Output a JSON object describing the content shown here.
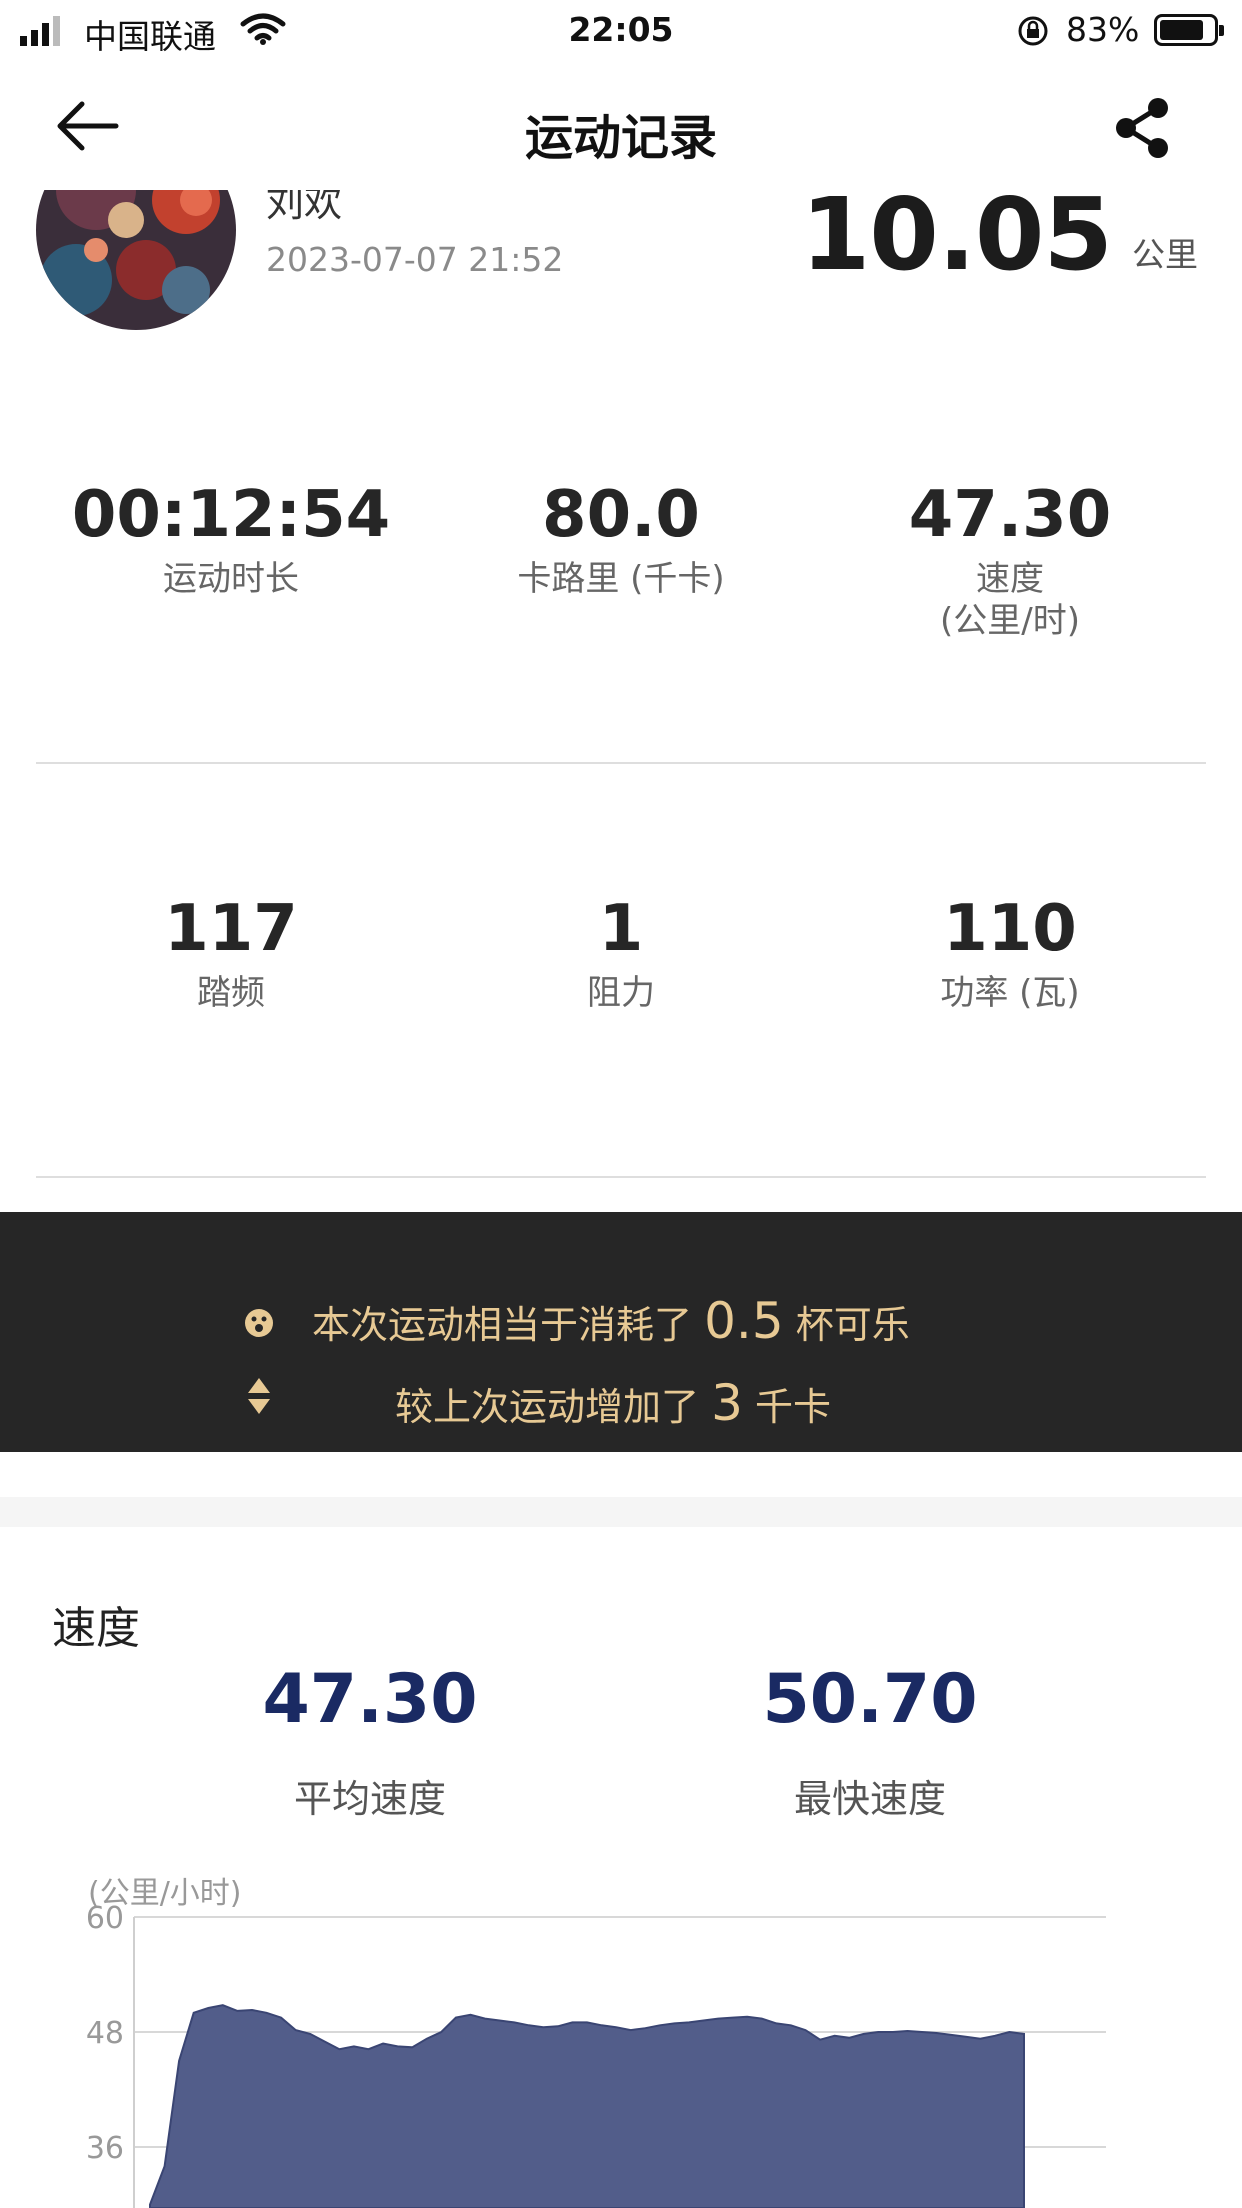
{
  "status_bar": {
    "carrier": "中国联通",
    "time": "22:05",
    "battery": "83%",
    "battery_level": 0.83
  },
  "nav": {
    "title": "运动记录",
    "back_icon": "arrow-left-icon",
    "share_icon": "share-icon"
  },
  "profile": {
    "name": "刘欢",
    "date": "2023-07-07 21:52",
    "distance": "10.05",
    "distance_unit": "公里"
  },
  "stats_row1": [
    {
      "value": "00:12:54",
      "label": "运动时长",
      "label2": ""
    },
    {
      "value": "80.0",
      "label": "卡路里 (千卡)",
      "label2": ""
    },
    {
      "value": "47.30",
      "label": "速度",
      "label2": "(公里/时)"
    }
  ],
  "stats_row2": [
    {
      "value": "117",
      "label": "踏频"
    },
    {
      "value": "1",
      "label": "阻力"
    },
    {
      "value": "110",
      "label": "功率 (瓦)"
    }
  ],
  "banner": {
    "line1_prefix": "本次运动相当于消耗了",
    "line1_value": "0.5",
    "line1_suffix": "杯可乐",
    "line2_prefix": "较上次运动增加了",
    "line2_value": "3",
    "line2_suffix": "千卡",
    "accent_color": "#e7c994",
    "background_color": "#262626"
  },
  "speed_section": {
    "title": "速度",
    "avg_value": "47.30",
    "avg_label": "平均速度",
    "max_value": "50.70",
    "max_label": "最快速度"
  },
  "chart_data": {
    "type": "area",
    "ylabel": "(公里/小时)",
    "yticks": [
      "60",
      "48",
      "36"
    ],
    "ylim": [
      24,
      60
    ],
    "grid": true,
    "fill_color": "#525d8a",
    "x": [
      0,
      1,
      2,
      3,
      4,
      5,
      6,
      7,
      8,
      9,
      10,
      11,
      12,
      13,
      14,
      15,
      16,
      17,
      18,
      19,
      20,
      21,
      22,
      23,
      24,
      25,
      26,
      27,
      28,
      29,
      30,
      31,
      32,
      33,
      34,
      35,
      36,
      37,
      38,
      39,
      40,
      41,
      42,
      43,
      44,
      45,
      46,
      47,
      48,
      49,
      50,
      51,
      52,
      53,
      54,
      55,
      56,
      57,
      58,
      59,
      60
    ],
    "y": [
      30,
      34,
      45,
      50,
      50.5,
      50.8,
      50.2,
      50.3,
      50,
      49.5,
      48.2,
      47.8,
      47,
      46.2,
      46.5,
      46.2,
      46.8,
      46.5,
      46.4,
      47.3,
      48,
      49.5,
      49.8,
      49.4,
      49.2,
      49,
      48.7,
      48.5,
      48.6,
      49,
      49,
      48.7,
      48.5,
      48.2,
      48.4,
      48.7,
      48.9,
      49,
      49.2,
      49.4,
      49.5,
      49.6,
      49.4,
      48.9,
      48.7,
      48.2,
      47.2,
      47.6,
      47.4,
      47.8,
      48,
      48,
      48.1,
      48,
      47.9,
      47.7,
      47.5,
      47.3,
      47.6,
      48,
      47.8
    ]
  }
}
